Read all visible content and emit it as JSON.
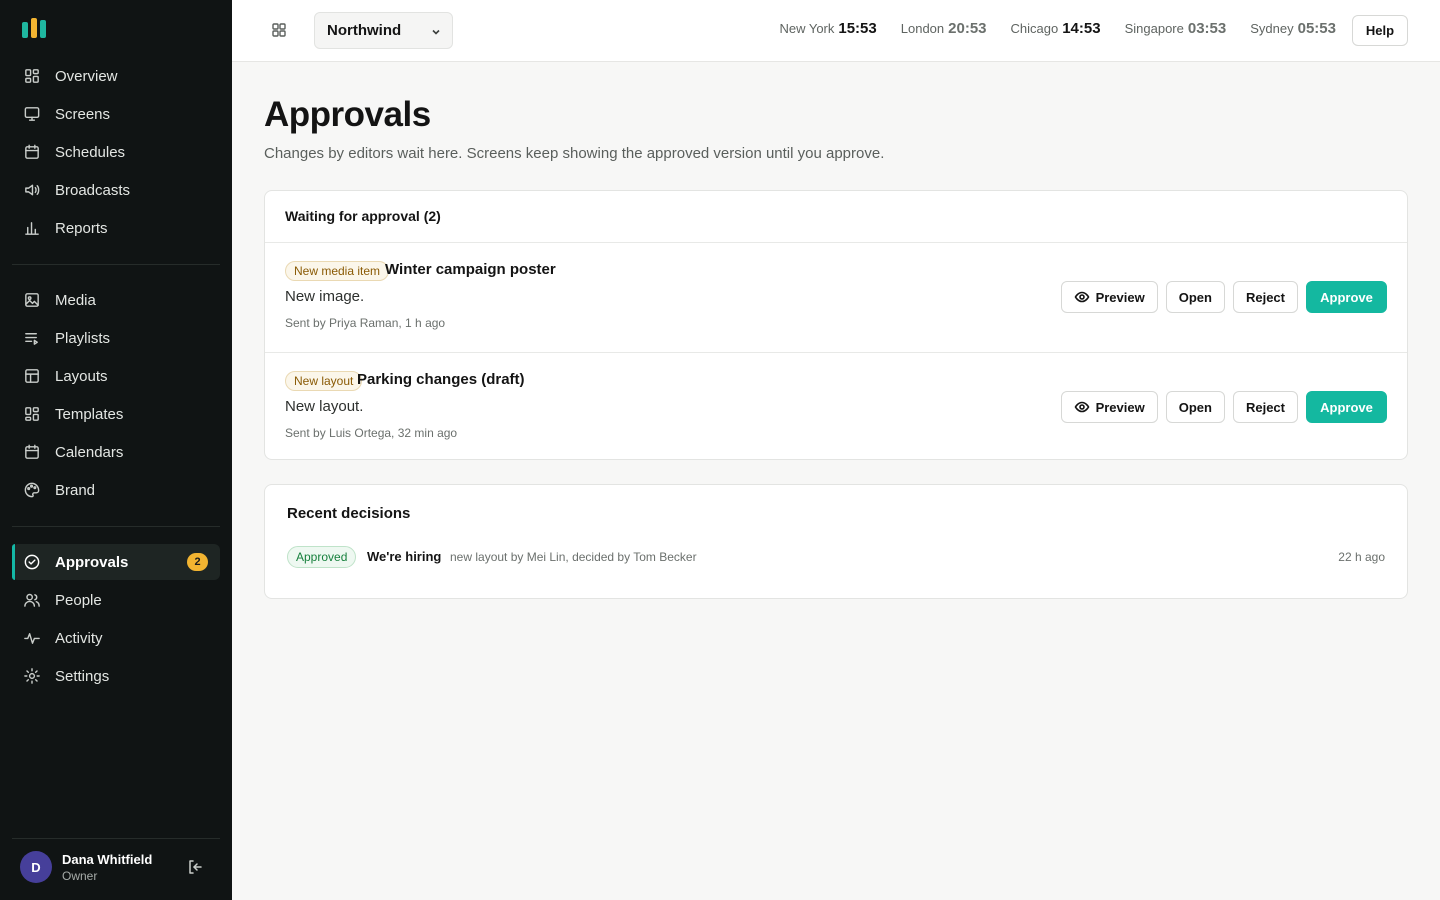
{
  "brand": {
    "accent": "#14b8a6",
    "logo_bar_colors": [
      "#1fb7a0",
      "#f2b431",
      "#1fb7a0"
    ]
  },
  "sidebar": {
    "groups": [
      [
        {
          "label": "Overview",
          "icon": "grid-icon"
        },
        {
          "label": "Screens",
          "icon": "monitor-icon"
        },
        {
          "label": "Schedules",
          "icon": "calendar-icon"
        },
        {
          "label": "Broadcasts",
          "icon": "speaker-icon"
        },
        {
          "label": "Reports",
          "icon": "bar-chart-icon"
        }
      ],
      [
        {
          "label": "Media",
          "icon": "image-icon"
        },
        {
          "label": "Playlists",
          "icon": "playlist-icon"
        },
        {
          "label": "Layouts",
          "icon": "layout-icon"
        },
        {
          "label": "Templates",
          "icon": "template-icon"
        },
        {
          "label": "Calendars",
          "icon": "calendar-icon"
        },
        {
          "label": "Brand",
          "icon": "palette-icon"
        }
      ],
      [
        {
          "label": "Approvals",
          "icon": "check-circle-icon",
          "active": true,
          "badge": "2"
        },
        {
          "label": "People",
          "icon": "users-icon"
        },
        {
          "label": "Activity",
          "icon": "pulse-icon"
        },
        {
          "label": "Settings",
          "icon": "gear-icon"
        }
      ]
    ],
    "user": {
      "initial": "D",
      "name": "Dana Whitfield",
      "role": "Owner"
    }
  },
  "topbar": {
    "org": "Northwind",
    "clocks": [
      {
        "city": "New York",
        "time": "15:53",
        "dim": false
      },
      {
        "city": "London",
        "time": "20:53",
        "dim": true
      },
      {
        "city": "Chicago",
        "time": "14:53",
        "dim": false
      },
      {
        "city": "Singapore",
        "time": "03:53",
        "dim": true
      },
      {
        "city": "Sydney",
        "time": "05:53",
        "dim": true
      }
    ],
    "help_label": "Help"
  },
  "main": {
    "title": "Approvals",
    "subtitle": "Changes by editors wait here. Screens keep showing the approved version until you approve.",
    "pending": {
      "heading": "Waiting for approval (2)",
      "items": [
        {
          "tag": "New media item",
          "title": "Winter campaign poster",
          "desc": "New image.",
          "meta": "Sent by Priya Raman, 1 h ago"
        },
        {
          "tag": "New layout",
          "title": "Parking changes (draft)",
          "desc": "New layout.",
          "meta": "Sent by Luis Ortega, 32 min ago"
        }
      ],
      "actions": {
        "preview": "Preview",
        "open": "Open",
        "reject": "Reject",
        "approve": "Approve"
      }
    },
    "recent": {
      "heading": "Recent decisions",
      "items": [
        {
          "status": "Approved",
          "title": "We're hiring",
          "desc": "new layout by Mei Lin, decided by Tom Becker",
          "time": "22 h ago"
        }
      ]
    }
  }
}
